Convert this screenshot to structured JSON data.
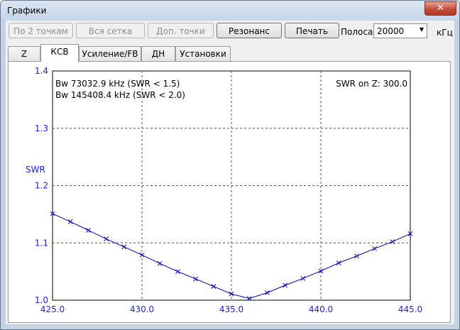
{
  "window": {
    "title": "Графики",
    "close_label": "✕"
  },
  "toolbar": {
    "btn_two_points": "По 2 точкам",
    "btn_all_grid": "Вся сетка",
    "btn_extra_points": "Доп. точки",
    "btn_resonance": "Резонанс",
    "btn_print": "Печать",
    "band_label": "Полоса",
    "band_value": "20000",
    "band_unit": "кГц"
  },
  "tabs": [
    {
      "label": "Z"
    },
    {
      "label": "КСВ"
    },
    {
      "label": "Усиление/FB"
    },
    {
      "label": "ДН"
    },
    {
      "label": "Установки"
    }
  ],
  "chart_data": {
    "type": "line",
    "ylabel": "SWR",
    "xlim": [
      425.0,
      445.0
    ],
    "ylim": [
      1.0,
      1.4
    ],
    "x_ticks": [
      "425.0",
      "430.0",
      "435.0",
      "440.0",
      "445.0"
    ],
    "y_ticks": [
      "1.0",
      "1.1",
      "1.2",
      "1.3",
      "1.4"
    ],
    "grid": true,
    "annotations": [
      "Bw 73032.9 kHz (SWR < 1.5)",
      "Bw 145408.4 kHz (SWR < 2.0)",
      "SWR on Z: 300.0"
    ],
    "series": [
      {
        "color": "#0000c8",
        "x": [
          425.0,
          426.0,
          427.0,
          428.0,
          429.0,
          430.0,
          431.0,
          432.0,
          433.0,
          434.0,
          435.0,
          436.0,
          437.0,
          438.0,
          439.0,
          440.0,
          441.0,
          442.0,
          443.0,
          444.0,
          445.0
        ],
        "y": [
          1.151,
          1.137,
          1.122,
          1.107,
          1.093,
          1.079,
          1.064,
          1.05,
          1.037,
          1.024,
          1.011,
          1.003,
          1.013,
          1.026,
          1.038,
          1.051,
          1.065,
          1.077,
          1.09,
          1.102,
          1.116
        ]
      }
    ]
  }
}
